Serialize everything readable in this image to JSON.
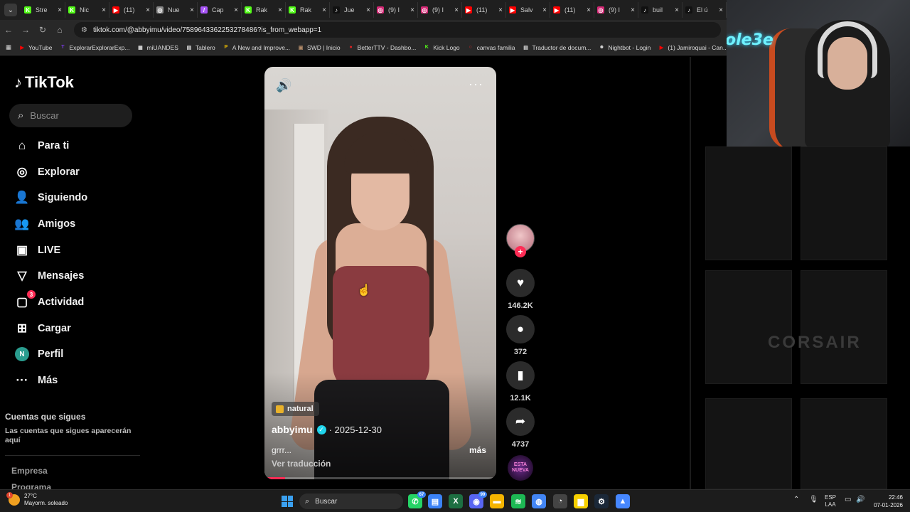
{
  "browser": {
    "tabs": [
      {
        "title": "Stre",
        "color": "#53fc18",
        "glyph": "K"
      },
      {
        "title": "Nic",
        "color": "#53fc18",
        "glyph": "K"
      },
      {
        "title": "(11)",
        "color": "#ff0000",
        "glyph": "▶"
      },
      {
        "title": "Nue",
        "color": "#888888",
        "glyph": "◎"
      },
      {
        "title": "Cap",
        "color": "#a855f7",
        "glyph": "/"
      },
      {
        "title": "Rak",
        "color": "#53fc18",
        "glyph": "K"
      },
      {
        "title": "Rak",
        "color": "#53fc18",
        "glyph": "K"
      },
      {
        "title": "Jue",
        "color": "#111111",
        "glyph": "♪"
      },
      {
        "title": "(9) I",
        "color": "#d62976",
        "glyph": "◎"
      },
      {
        "title": "(9) I",
        "color": "#d62976",
        "glyph": "◎"
      },
      {
        "title": "(11)",
        "color": "#ff0000",
        "glyph": "▶"
      },
      {
        "title": "Salv",
        "color": "#ff0000",
        "glyph": "▶"
      },
      {
        "title": "(11)",
        "color": "#ff0000",
        "glyph": "▶"
      },
      {
        "title": "(9) I",
        "color": "#d62976",
        "glyph": "◎"
      },
      {
        "title": "buil",
        "color": "#111111",
        "glyph": "♪"
      },
      {
        "title": "El ú",
        "color": "#111111",
        "glyph": "♪"
      }
    ],
    "url": "tiktok.com/@abbyimu/video/7589643362253278486?is_from_webapp=1",
    "bookmarks": [
      {
        "label": "YouTube",
        "color": "#ff0000",
        "glyph": "▶"
      },
      {
        "label": "ExplorarExplorarExp...",
        "color": "#7c3aed",
        "glyph": "T"
      },
      {
        "label": "miUANDES",
        "color": "#dddddd",
        "glyph": "▦"
      },
      {
        "label": "Tablero",
        "color": "#dddddd",
        "glyph": "▤"
      },
      {
        "label": "A New and Improve...",
        "color": "#f0c000",
        "glyph": "P"
      },
      {
        "label": "SWD | Inicio",
        "color": "#b08968",
        "glyph": "▣"
      },
      {
        "label": "BetterTTV - Dashbo...",
        "color": "#e02424",
        "glyph": "●"
      },
      {
        "label": "Kick Logo",
        "color": "#53fc18",
        "glyph": "K"
      },
      {
        "label": "canvas familia",
        "color": "#e02424",
        "glyph": "○"
      },
      {
        "label": "Traductor de docum...",
        "color": "#dddddd",
        "glyph": "▤"
      },
      {
        "label": "Nightbot - Login",
        "color": "#dddddd",
        "glyph": "☻"
      },
      {
        "label": "(1) Jamiroquai - Can...",
        "color": "#ff0000",
        "glyph": "▶"
      }
    ]
  },
  "sidebar": {
    "logo": "TikTok",
    "search_placeholder": "Buscar",
    "nav": [
      {
        "label": "Para ti",
        "icon": "home-icon",
        "glyph": "⌂"
      },
      {
        "label": "Explorar",
        "icon": "compass-icon",
        "glyph": "◎"
      },
      {
        "label": "Siguiendo",
        "icon": "following-icon",
        "glyph": "👤"
      },
      {
        "label": "Amigos",
        "icon": "friends-icon",
        "glyph": "👥"
      },
      {
        "label": "LIVE",
        "icon": "live-icon",
        "glyph": "▣"
      },
      {
        "label": "Mensajes",
        "icon": "messages-icon",
        "glyph": "▽"
      },
      {
        "label": "Actividad",
        "icon": "activity-icon",
        "glyph": "▢",
        "badge": "3"
      },
      {
        "label": "Cargar",
        "icon": "upload-icon",
        "glyph": "⊞"
      },
      {
        "label": "Perfil",
        "icon": "profile-avatar-icon",
        "glyph": "N"
      },
      {
        "label": "Más",
        "icon": "more-icon",
        "glyph": "···"
      }
    ],
    "following_title": "Cuentas que sigues",
    "following_desc": "Las cuentas que sigues aparecerán aquí",
    "footer": [
      "Empresa",
      "Programa"
    ]
  },
  "video": {
    "tag": "natural",
    "author": "abbyimu",
    "date": "· 2025-12-30",
    "caption": "grrr...",
    "more": "más",
    "translate": "Ver traducción",
    "progress": 0.09
  },
  "actions": {
    "likes": "146.2K",
    "comments": "372",
    "saves": "12.1K",
    "shares": "4737",
    "music_label": "ESTA NUEVA"
  },
  "webcam": {
    "neon": "ole3e"
  },
  "background_brand": "CORSAIR",
  "taskbar": {
    "weather_temp": "27°C",
    "weather_desc": "Mayorm. soleado",
    "weather_badge": "1",
    "search": "Buscar",
    "lang_top": "ESP",
    "lang_bottom": "LAA",
    "time": "22:46",
    "date": "07-01-2026",
    "apps": [
      {
        "name": "whatsapp-app",
        "color": "#25d366",
        "glyph": "✆",
        "badge": "67"
      },
      {
        "name": "notepad-app",
        "color": "#3b82f6",
        "glyph": "▤"
      },
      {
        "name": "excel-app",
        "color": "#1d6f42",
        "glyph": "X"
      },
      {
        "name": "discord-app",
        "color": "#5865f2",
        "glyph": "◉",
        "badge": "99"
      },
      {
        "name": "files-app",
        "color": "#f5b400",
        "glyph": "▬"
      },
      {
        "name": "spotify-app",
        "color": "#1db954",
        "glyph": "≋"
      },
      {
        "name": "chrome-app",
        "color": "#4285f4",
        "glyph": "◍"
      },
      {
        "name": "obs-app",
        "color": "#444444",
        "glyph": "◔"
      },
      {
        "name": "sticky-notes-app",
        "color": "#f7d000",
        "glyph": "▆"
      },
      {
        "name": "steam-app",
        "color": "#1b2838",
        "glyph": "⚙"
      },
      {
        "name": "nordvpn-app",
        "color": "#4687ff",
        "glyph": "▲"
      }
    ]
  }
}
